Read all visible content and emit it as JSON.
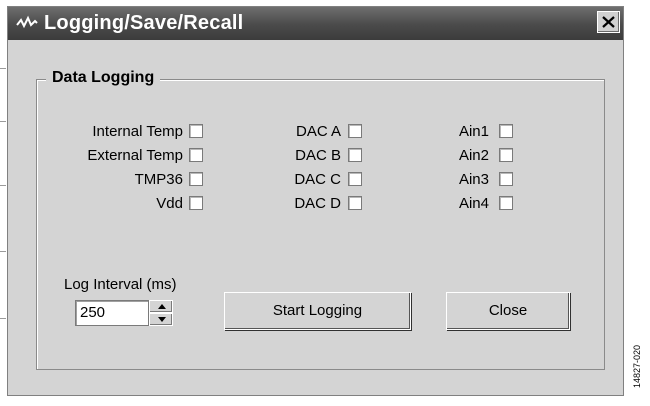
{
  "window": {
    "title": "Logging/Save/Recall",
    "icon": "waveform-icon",
    "close_icon": "close-icon"
  },
  "group": {
    "title": "Data  Logging"
  },
  "checkboxes": {
    "col1": [
      {
        "label": "Internal Temp",
        "checked": false
      },
      {
        "label": "External Temp",
        "checked": false
      },
      {
        "label": "TMP36",
        "checked": false
      },
      {
        "label": "Vdd",
        "checked": false
      }
    ],
    "col2": [
      {
        "label": "DAC A",
        "checked": false
      },
      {
        "label": "DAC B",
        "checked": false
      },
      {
        "label": "DAC C",
        "checked": false
      },
      {
        "label": "DAC D",
        "checked": false
      }
    ],
    "col3": [
      {
        "label": "Ain1",
        "checked": false
      },
      {
        "label": "Ain2",
        "checked": false
      },
      {
        "label": "Ain3",
        "checked": false
      },
      {
        "label": "Ain4",
        "checked": false
      }
    ]
  },
  "log_interval": {
    "label": "Log Interval (ms)",
    "value": "250"
  },
  "buttons": {
    "start": "Start Logging",
    "close": "Close"
  },
  "figure_id": "14827-020",
  "colors": {
    "window_bg": "#d4d4d4",
    "titlebar": "#4a4a4a",
    "title_text": "#ffffff"
  }
}
